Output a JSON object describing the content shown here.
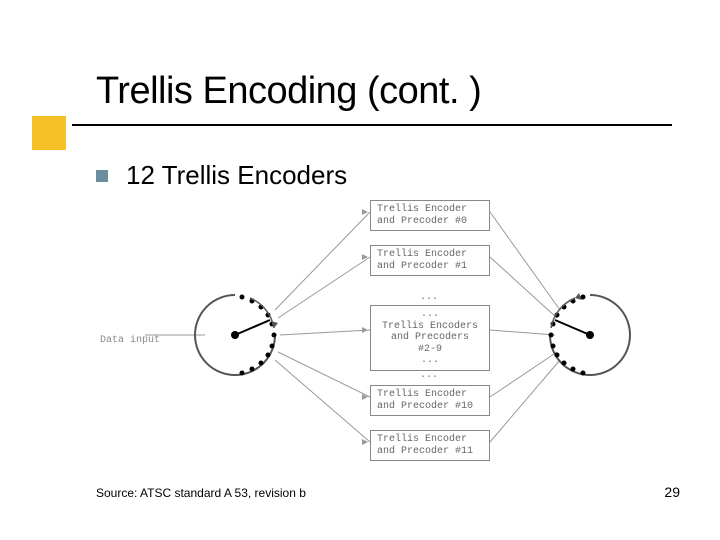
{
  "title": "Trellis Encoding (cont. )",
  "bullet": "12 Trellis Encoders",
  "footer_source": "Source: ATSC standard A 53, revision b",
  "page_number": "29",
  "diagram": {
    "input_label": "Data input",
    "encoder_top_line": "Trellis Encoder",
    "encoder_sub_line": "and Precoder",
    "box0": "#0",
    "box1": "#1",
    "box_mid_top": "Trellis Encoders",
    "box_mid_sub": "and Precoders",
    "box_mid_range": "#2-9",
    "box10": "#10",
    "box11": "#11",
    "ellipsis": "..."
  }
}
